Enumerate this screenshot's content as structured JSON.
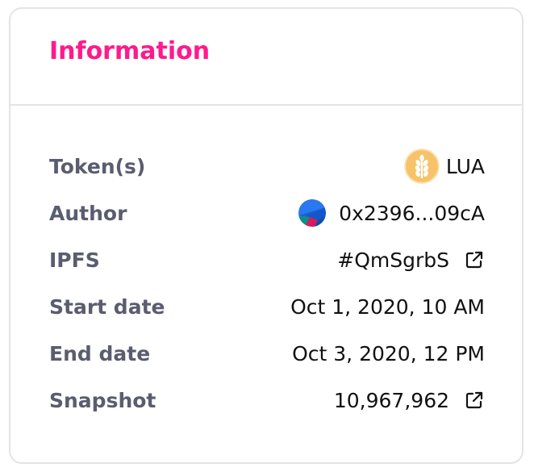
{
  "card": {
    "title": "Information"
  },
  "rows": {
    "tokens": {
      "label": "Token(s)",
      "value": "LUA",
      "icon": "lua-token-icon"
    },
    "author": {
      "label": "Author",
      "value": "0x2396...09cA",
      "icon": "author-avatar"
    },
    "ipfs": {
      "label": "IPFS",
      "value": "#QmSgrbS",
      "icon": "external-link-icon"
    },
    "start_date": {
      "label": "Start date",
      "value": "Oct 1, 2020, 10 AM"
    },
    "end_date": {
      "label": "End date",
      "value": "Oct 3, 2020, 12 PM"
    },
    "snapshot": {
      "label": "Snapshot",
      "value": "10,967,962",
      "icon": "external-link-icon"
    }
  },
  "colors": {
    "title": "#ff1a8c",
    "label": "#5a5d6f",
    "value": "#111111",
    "border": "#e4e4e7",
    "token_bg": "#f6c36a"
  }
}
